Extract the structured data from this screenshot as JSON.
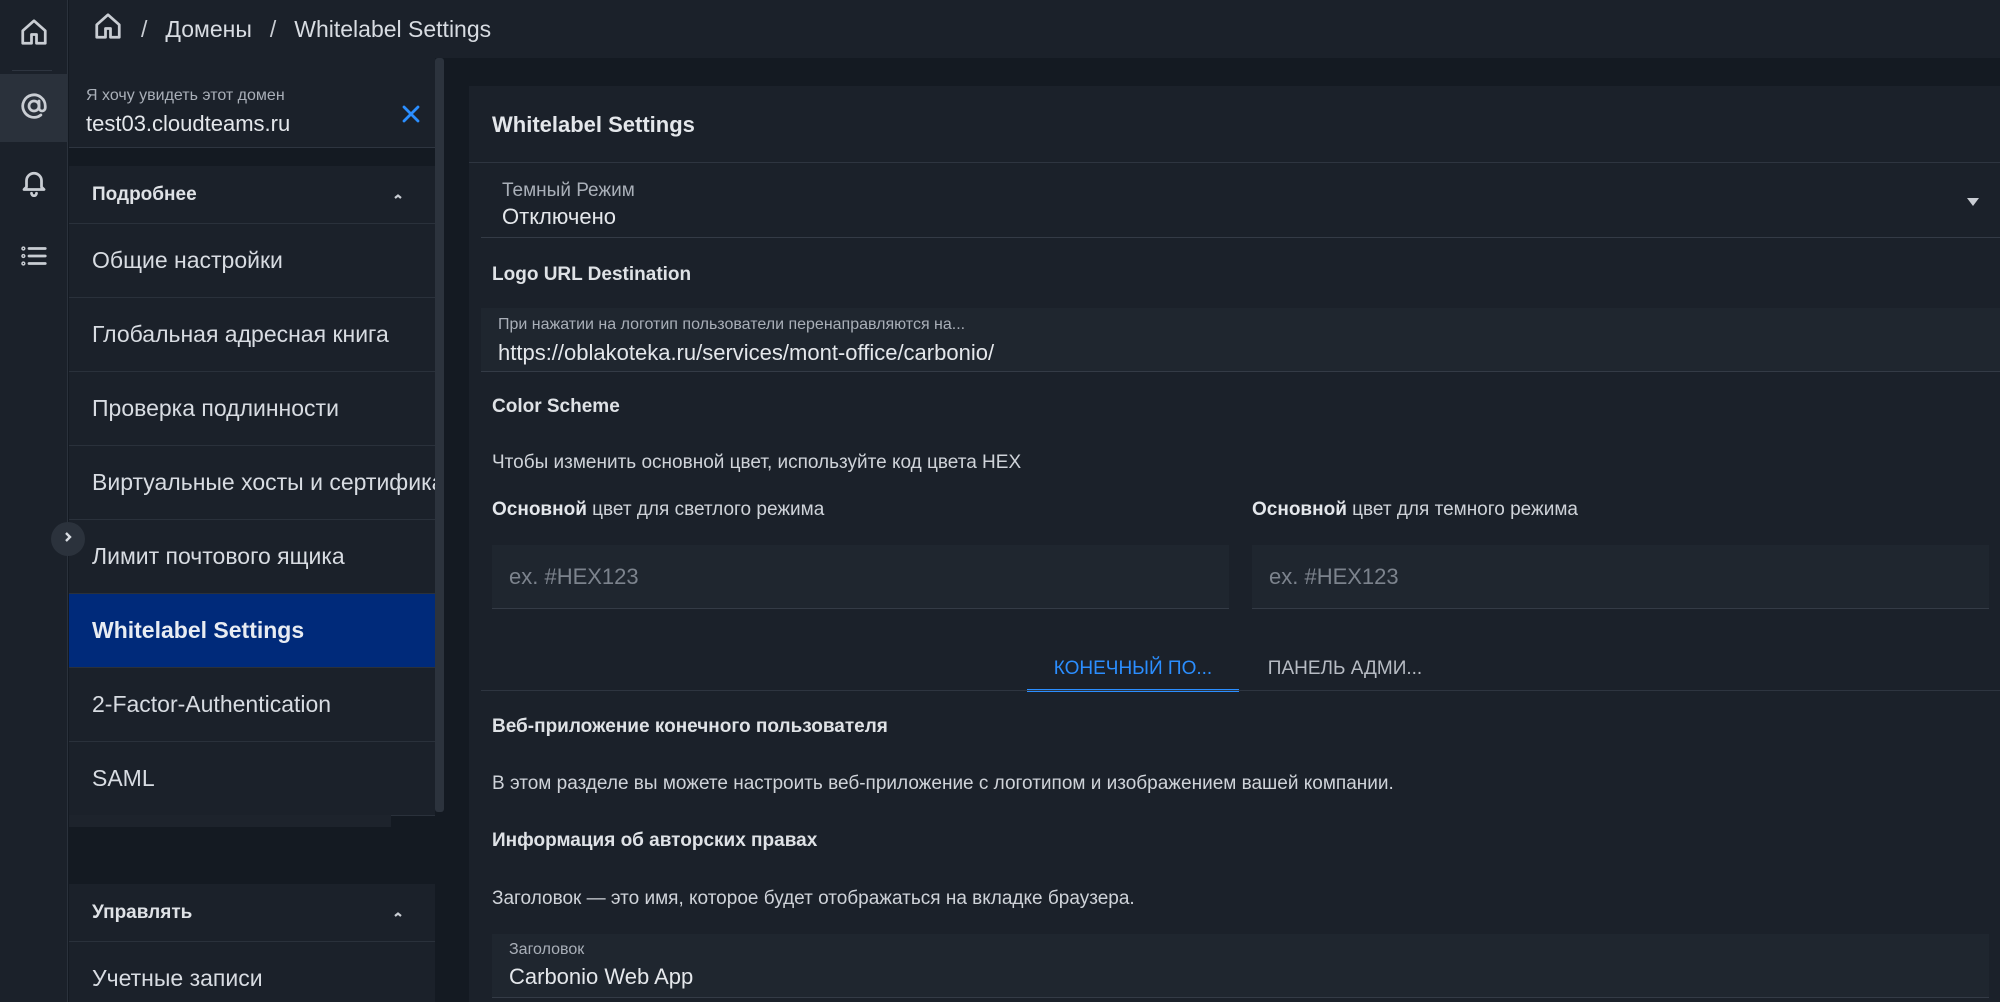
{
  "rail": {
    "items": [
      {
        "icon": "home-icon"
      },
      {
        "icon": "at-sign-icon"
      },
      {
        "icon": "bell-icon"
      },
      {
        "icon": "list-icon"
      }
    ]
  },
  "breadcrumb": {
    "separator": "/",
    "domains": "Домены",
    "current": "Whitelabel Settings"
  },
  "domain_picker": {
    "label": "Я хочу увидеть этот домен",
    "value": "test03.cloudteams.ru"
  },
  "sidebar": {
    "group_details": "Подробнее",
    "items": [
      {
        "label": "Общие настройки"
      },
      {
        "label": "Глобальная адресная книга"
      },
      {
        "label": "Проверка подлинности"
      },
      {
        "label": "Виртуальные хосты и сертифика"
      },
      {
        "label": "Лимит почтового ящика"
      },
      {
        "label": "Whitelabel Settings"
      },
      {
        "label": "2-Factor-Authentication"
      },
      {
        "label": "SAML"
      }
    ],
    "group_manage": "Управлять",
    "manage_items": [
      {
        "label": "Учетные записи"
      }
    ]
  },
  "main": {
    "title": "Whitelabel Settings",
    "dark_mode": {
      "label": "Темный Режим",
      "value": "Отключено"
    },
    "logo_url": {
      "heading": "Logo URL Destination",
      "label": "При нажатии на логотип пользователи перенаправляются на...",
      "value": "https://oblakoteka.ru/services/mont-office/carbonio/"
    },
    "color_scheme": {
      "heading": "Color Scheme",
      "hint": "Чтобы изменить основной цвет, используйте код цвета HEX",
      "light_bold": "Основной",
      "light_rest": " цвет для светлого режима",
      "dark_bold": "Основной",
      "dark_rest": " цвет для темного режима",
      "placeholder": "ex. #HEX123"
    },
    "tabs": [
      {
        "label": "КОНЕЧНЫЙ ПО..."
      },
      {
        "label": "ПАНЕЛЬ АДМИ..."
      }
    ],
    "webapp": {
      "heading": "Веб-приложение конечного пользователя",
      "description": "В этом разделе вы можете настроить веб-приложение с логотипом и изображением вашей компании."
    },
    "copyright": {
      "heading": "Информация об авторских правах",
      "description": "Заголовок — это имя, которое будет отображаться на вкладке браузера.",
      "field_label": "Заголовок",
      "field_value": "Carbonio Web App"
    }
  },
  "colors": {
    "accent": "#2b8eff",
    "active_nav": "#002a7a",
    "background": "#141a22",
    "panel": "#1b212a"
  }
}
